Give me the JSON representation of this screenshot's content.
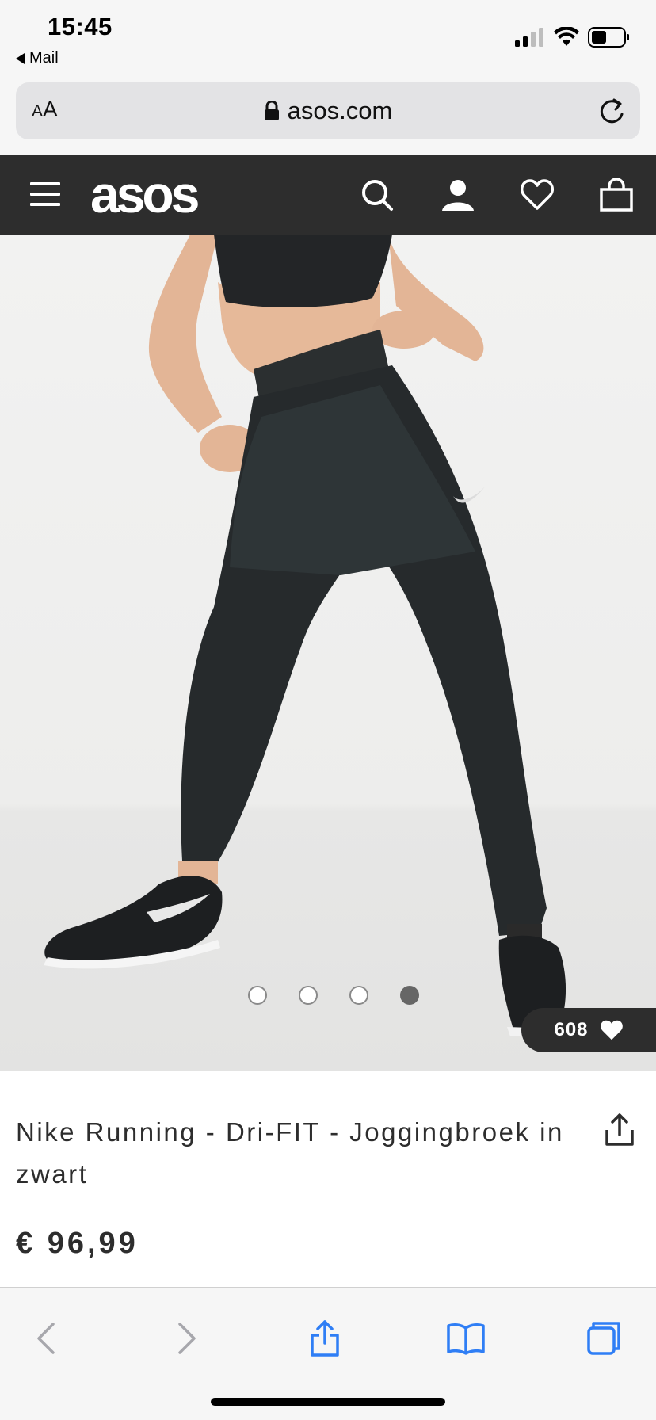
{
  "status_bar": {
    "time": "15:45",
    "back_app": "Mail",
    "icons": [
      "cellular-signal-icon",
      "wifi-icon",
      "battery-icon"
    ]
  },
  "browser": {
    "text_size_button": {
      "small": "A",
      "large": "A"
    },
    "url": "asos.com",
    "lock_icon": "lock-icon",
    "reload_icon": "reload-icon"
  },
  "site_header": {
    "logo": "asos",
    "icons": [
      "menu-icon",
      "search-icon",
      "account-icon",
      "wishlist-heart-icon",
      "shopping-bag-icon"
    ]
  },
  "gallery": {
    "image_count": 4,
    "active_index": 4,
    "saved_count": "608"
  },
  "product": {
    "title": "Nike Running - Dri-FIT - Joggingbroek in zwart",
    "price": "€ 96,99"
  },
  "toolbar": {
    "icons": [
      "back-icon",
      "forward-icon",
      "share-icon",
      "bookmarks-icon",
      "tabs-icon"
    ]
  },
  "colors": {
    "header_bg": "#2d2d2d",
    "toolbar_accent": "#2f7ef5",
    "toolbar_disabled": "#a7a7ac"
  }
}
